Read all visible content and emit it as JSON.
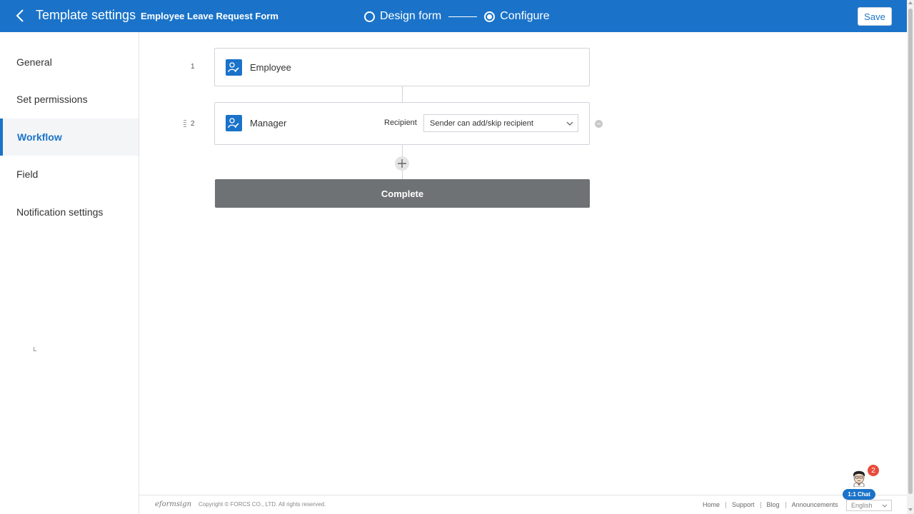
{
  "header": {
    "title": "Template settings",
    "form_name": "Employee Leave Request Form",
    "steps": [
      {
        "label": "Design form",
        "selected": false
      },
      {
        "label": "Configure",
        "selected": true
      }
    ],
    "save_label": "Save"
  },
  "sidebar": {
    "items": [
      {
        "label": "General",
        "active": false
      },
      {
        "label": "Set permissions",
        "active": false
      },
      {
        "label": "Workflow",
        "active": true
      },
      {
        "label": "Field",
        "active": false
      },
      {
        "label": "Notification settings",
        "active": false
      }
    ]
  },
  "workflow": {
    "steps": [
      {
        "number": "1",
        "name": "Employee"
      },
      {
        "number": "2",
        "name": "Manager",
        "recipient_label": "Recipient",
        "recipient_value": "Sender can add/skip recipient"
      }
    ],
    "complete_label": "Complete"
  },
  "footer": {
    "brand": "eformsign",
    "copyright": "Copyright © FORCS CO., LTD. All rights reserved.",
    "links": [
      "Home",
      "Support",
      "Blog",
      "Announcements"
    ],
    "language": "English"
  },
  "chat": {
    "label": "1:1 Chat",
    "badge_count": "2"
  },
  "colors": {
    "primary": "#1a73c9",
    "complete_bar": "#6e7274",
    "badge": "#e74c3c"
  },
  "icons": [
    "chevron-left-icon",
    "radio-icon",
    "user-edit-icon",
    "chevron-down-icon",
    "minus-circle-icon",
    "plus-icon",
    "drag-handle-icon"
  ]
}
